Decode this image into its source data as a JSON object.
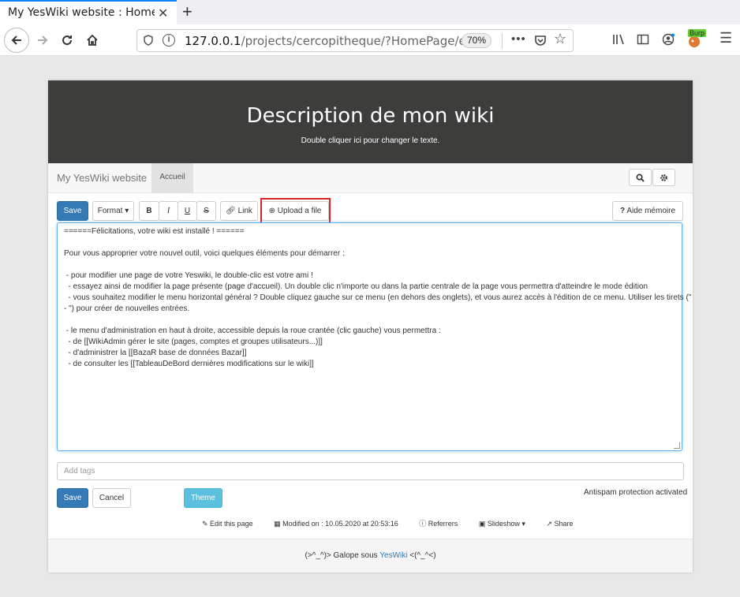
{
  "browser": {
    "tab_title": "My YesWiki website : HomeP",
    "tab_close": "✕",
    "new_tab": "+",
    "url_host": "127.0.0.1",
    "url_path": "/projects/cercopitheque/?HomePage/edit",
    "zoom": "70%",
    "burp_label": "Burp"
  },
  "hero": {
    "title": "Description de mon wiki",
    "subtitle": "Double cliquer ici pour changer le texte."
  },
  "sitenav": {
    "brand": "My YesWiki website",
    "accueil": "Accueil"
  },
  "toolbar": {
    "save": "Save",
    "format": "Format ▾",
    "bold": "B",
    "italic": "I",
    "underline": "U",
    "strike": "S",
    "link": "Link",
    "upload": "Upload a file",
    "aide": "Aide mémoire"
  },
  "editor": {
    "lines": [
      "======Félicitations, votre wiki est installé ! ======",
      "",
      "Pour vous approprier votre nouvel outil, voici quelques éléments pour démarrer :",
      "",
      " - pour modifier une page de votre Yeswiki, le double-clic est votre ami !",
      "  - essayez ainsi de modifier la page présente (page d'accueil). Un double clic n'importe ou dans la partie centrale de la page vous permettra d'atteindre le mode édition",
      "  - vous souhaitez modifier le menu horizontal général ? Double cliquez gauche sur ce menu (en dehors des onglets), et vous aurez accès à l'édition de ce menu. Utiliser les tirets (\"",
      "- \") pour créer de nouvelles entrées.",
      "",
      " - le menu d'administration en haut à droite, accessible depuis la roue crantée (clic gauche) vous permettra :",
      "  - de [[WikiAdmin gérer le site (pages, comptes et groupes utilisateurs...)]]",
      "  - d'administrer la [[BazaR base de données Bazar]]",
      "  - de consulter les [[TableauDeBord dernières modifications sur le wiki]]"
    ]
  },
  "form": {
    "tags_placeholder": "Add tags",
    "save": "Save",
    "cancel": "Cancel",
    "theme": "Theme",
    "antispam": "Antispam protection activated"
  },
  "footer": {
    "edit": "Edit this page",
    "modified": "Modified on : 10.05.2020 at 20:53:16",
    "referrers": "Referrers",
    "slideshow": "Slideshow ▾",
    "share": "Share",
    "credits_pre": "(>^_^)> Galope sous ",
    "credits_link": "YesWiki",
    "credits_post": " <(^_^<)"
  }
}
